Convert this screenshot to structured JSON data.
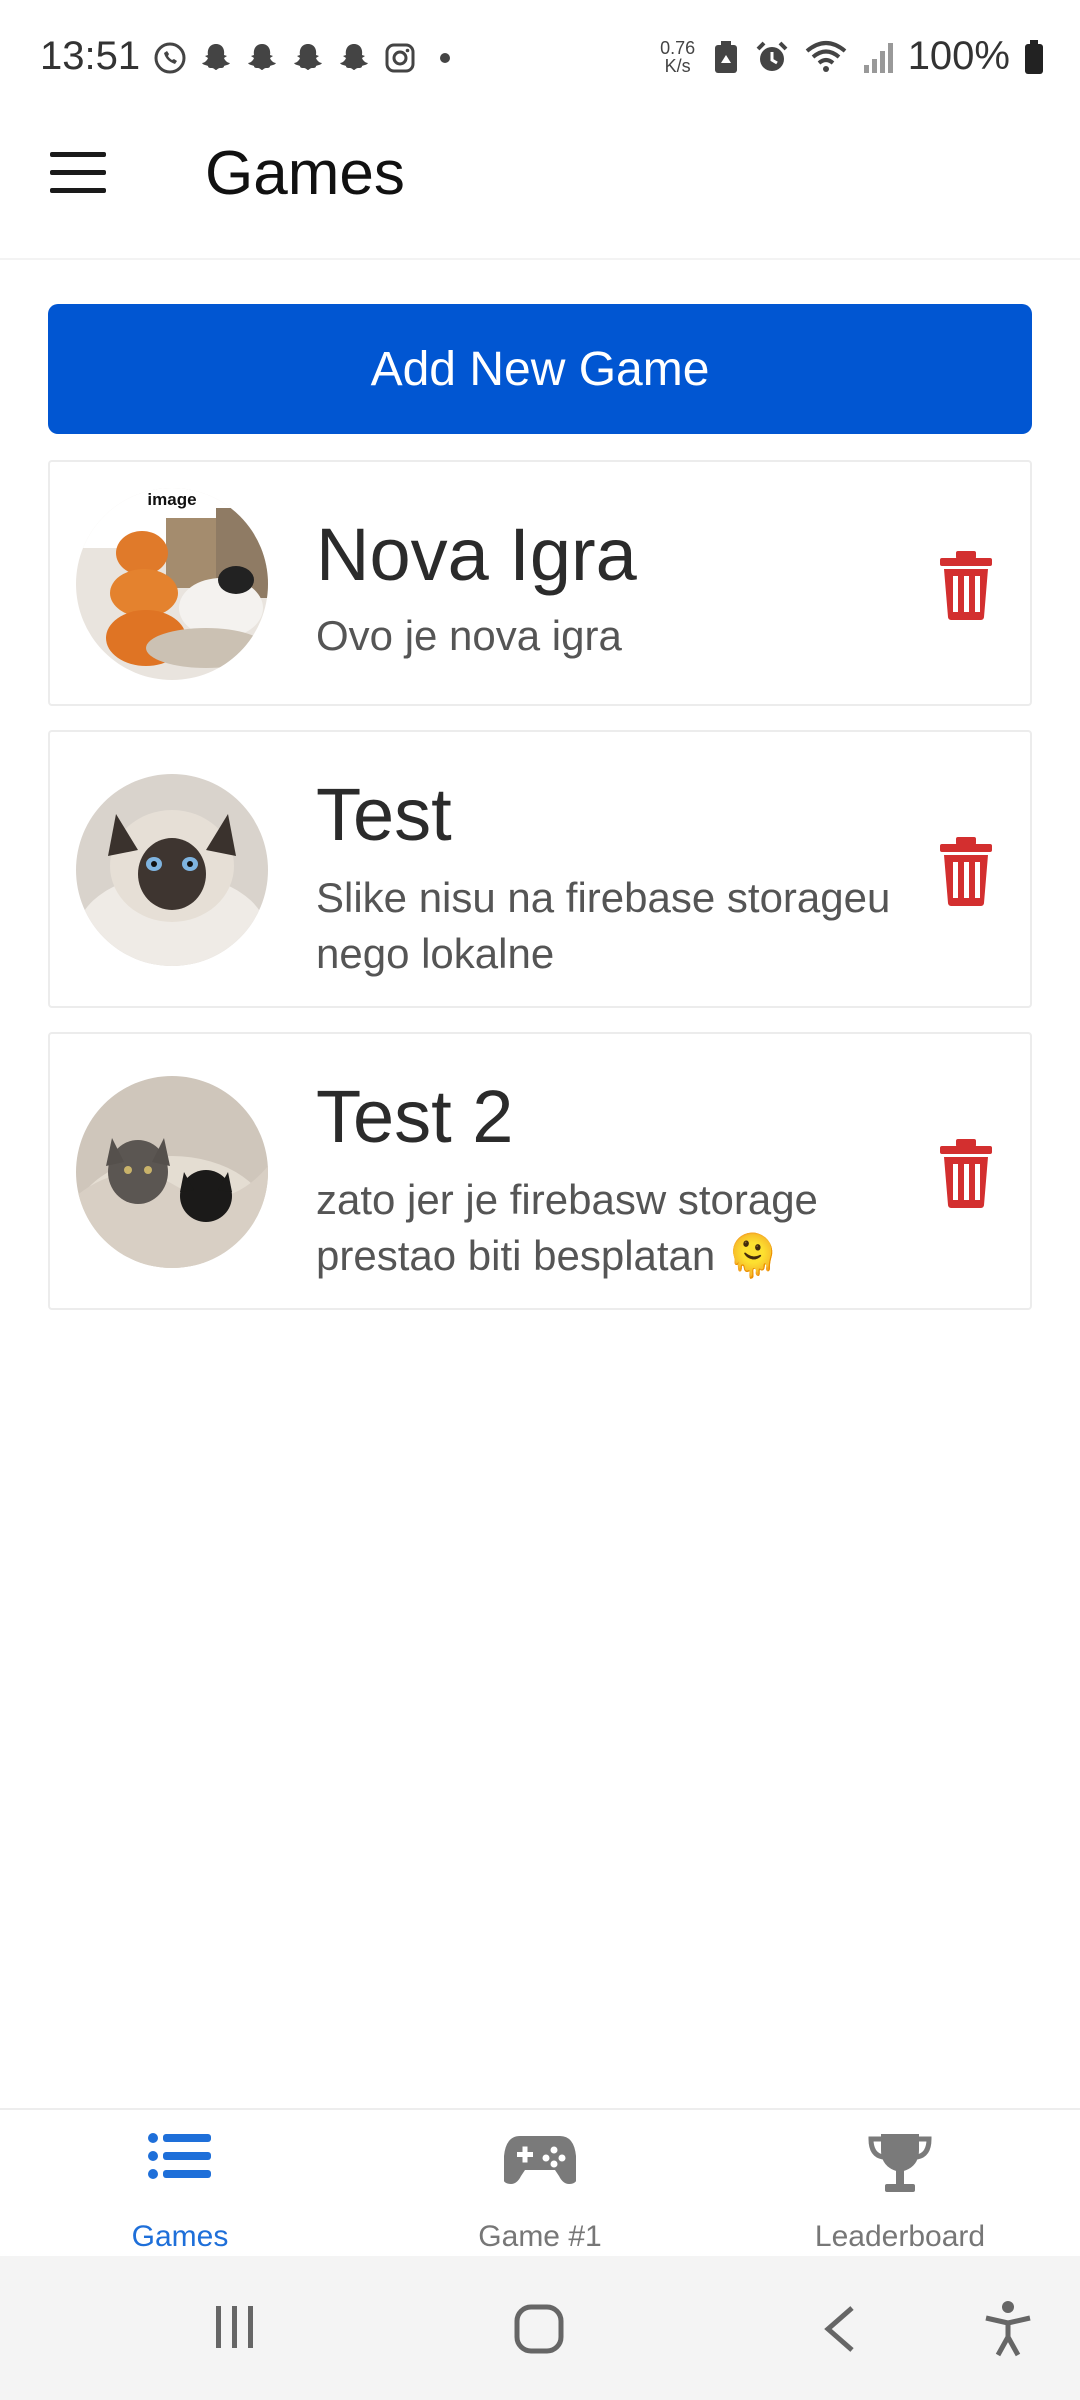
{
  "status_bar": {
    "time": "13:51",
    "speed_value": "0.76",
    "speed_unit": "K/s",
    "battery": "100%"
  },
  "app_bar": {
    "title": "Games"
  },
  "actions": {
    "add_label": "Add New Game"
  },
  "games": [
    {
      "title": "Nova Igra",
      "description": "Ovo je nova igra",
      "thumb_caption": "image"
    },
    {
      "title": "Test",
      "description": "Slike nisu na firebase storageu nego lokalne"
    },
    {
      "title": "Test 2",
      "description": "zato jer je firebasw storage prestao biti besplatan 🫠"
    }
  ],
  "bottom_nav": [
    {
      "label": "Games",
      "active": true
    },
    {
      "label": "Game #1",
      "active": false
    },
    {
      "label": "Leaderboard",
      "active": false
    }
  ],
  "colors": {
    "primary": "#0156d2",
    "delete": "#d32f2f",
    "nav_active": "#1e6fd9",
    "nav_inactive": "#777777"
  }
}
